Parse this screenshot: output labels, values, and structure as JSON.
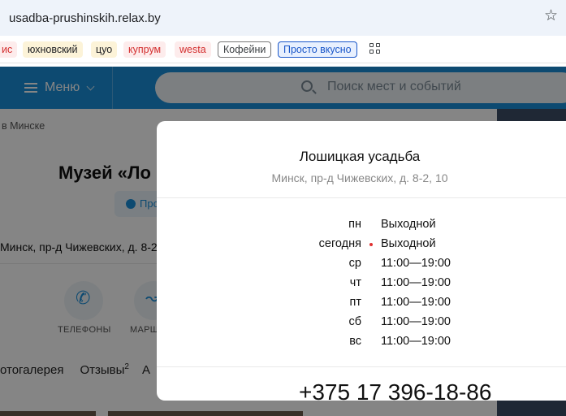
{
  "browser": {
    "url": "usadba-prushinskih.relax.by",
    "bookmarks": [
      "ис",
      "юхновский",
      "цуо",
      "купрум",
      "westa",
      "Кофейни",
      "Просто вкусно"
    ]
  },
  "header": {
    "menu_label": "Меню",
    "search_placeholder": "Поиск мест и событий"
  },
  "page": {
    "breadcrumb": "в Минске",
    "title": "Музей «Ло",
    "badge_label": "Про",
    "address": "Минск, пр-д Чижевских, д. 8-2,",
    "actions": [
      "ТЕЛЕФОНЫ",
      "МАРШ"
    ],
    "tabs": {
      "gallery": "отогалерея",
      "reviews": "Отзывы",
      "reviews_count": "2",
      "next": "А"
    }
  },
  "modal": {
    "title": "Лошицкая усадьба",
    "address": "Минск, пр-д Чижевских, д. 8-2, 10",
    "schedule": [
      {
        "day": "пн",
        "hours": "Выходной",
        "today": false
      },
      {
        "day": "сегодня",
        "hours": "Выходной",
        "today": true
      },
      {
        "day": "ср",
        "hours": "11:00—19:00",
        "today": false
      },
      {
        "day": "чт",
        "hours": "11:00—19:00",
        "today": false
      },
      {
        "day": "пт",
        "hours": "11:00—19:00",
        "today": false
      },
      {
        "day": "сб",
        "hours": "11:00—19:00",
        "today": false
      },
      {
        "day": "вс",
        "hours": "11:00—19:00",
        "today": false
      }
    ],
    "phone": "+375 17 396-18-86"
  },
  "colors": {
    "brand": "#1a8fd8",
    "today_dot": "#e03131"
  }
}
